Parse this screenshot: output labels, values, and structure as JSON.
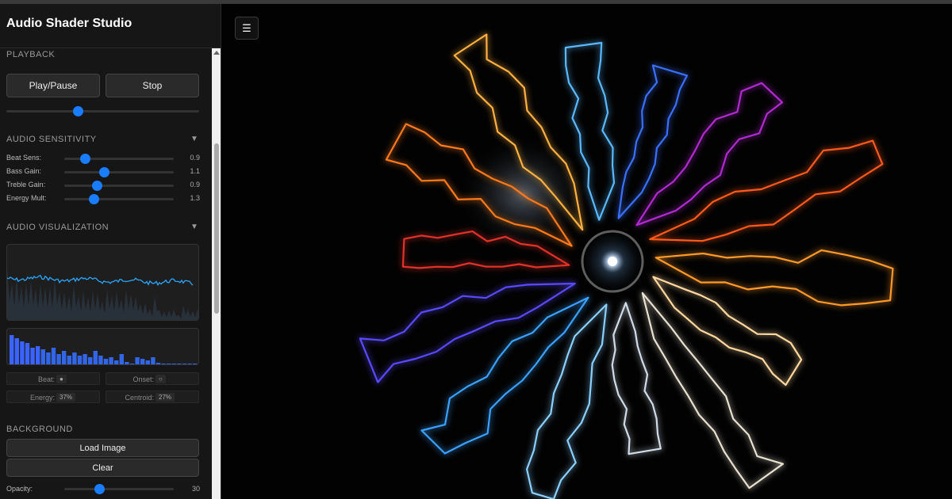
{
  "app": {
    "title": "Audio Shader Studio"
  },
  "playback": {
    "title": "PLAYBACK",
    "play_label": "Play/Pause",
    "stop_label": "Stop",
    "progress": 0.37
  },
  "sensitivity": {
    "title": "AUDIO SENSITIVITY",
    "caret": "▼",
    "rows": [
      {
        "label": "Beat Sens:",
        "value": "0.9",
        "fraction": 0.19
      },
      {
        "label": "Bass Gain:",
        "value": "1.1",
        "fraction": 0.36
      },
      {
        "label": "Treble Gain:",
        "value": "0.9",
        "fraction": 0.3
      },
      {
        "label": "Energy Mult:",
        "value": "1.3",
        "fraction": 0.27
      }
    ]
  },
  "visualization": {
    "title": "AUDIO VISUALIZATION",
    "caret": "▼",
    "beat_label": "Beat:",
    "beat_value": "●",
    "onset_label": "Onset:",
    "onset_value": "○",
    "energy_label": "Energy:",
    "energy_value": "37%",
    "centroid_label": "Centroid:",
    "centroid_value": "27%"
  },
  "background": {
    "title": "BACKGROUND",
    "load_label": "Load Image",
    "clear_label": "Clear",
    "opacity_label": "Opacity:",
    "opacity_value": "30",
    "opacity_fraction": 0.32
  },
  "canvas": {
    "menu_icon": "☰"
  },
  "colors": {
    "accent": "#1a7cff",
    "panel": "#161616"
  }
}
